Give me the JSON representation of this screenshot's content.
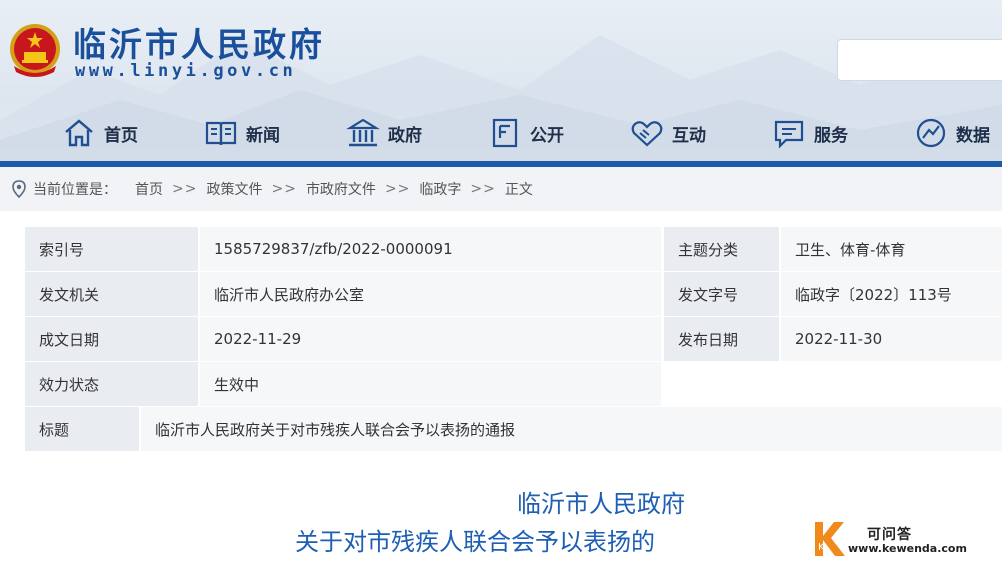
{
  "header": {
    "site_title": "临沂市人民政府",
    "site_url": "www.linyi.gov.cn",
    "search_placeholder": ""
  },
  "nav": [
    {
      "label": "首页",
      "icon": "home-icon"
    },
    {
      "label": "新闻",
      "icon": "news-icon"
    },
    {
      "label": "政府",
      "icon": "government-icon"
    },
    {
      "label": "公开",
      "icon": "document-icon"
    },
    {
      "label": "互动",
      "icon": "handshake-icon"
    },
    {
      "label": "服务",
      "icon": "chat-icon"
    },
    {
      "label": "数据",
      "icon": "data-icon"
    }
  ],
  "breadcrumb": {
    "prefix": "当前位置是：",
    "items": [
      "首页",
      "政策文件",
      "市政府文件",
      "临政字",
      "正文"
    ],
    "separator": ">>"
  },
  "info": {
    "index_label": "索引号",
    "index_value": "1585729837/zfb/2022-0000091",
    "topic_label": "主题分类",
    "topic_value": "卫生、体育-体育",
    "issuer_label": "发文机关",
    "issuer_value": "临沂市人民政府办公室",
    "docno_label": "发文字号",
    "docno_value": "临政字〔2022〕113号",
    "created_label": "成文日期",
    "created_value": "2022-11-29",
    "published_label": "发布日期",
    "published_value": "2022-11-30",
    "status_label": "效力状态",
    "status_value": "生效中",
    "title_label": "标题",
    "title_value": "临沂市人民政府关于对市残疾人联合会予以表扬的通报"
  },
  "document": {
    "title_line1": "临沂市人民政府",
    "title_line2": "关于对市残疾人联合会予以表扬的"
  },
  "watermark": {
    "letter": "K",
    "name": "可问答",
    "url": "www.kewenda.com"
  },
  "colors": {
    "brand_blue": "#1a4f9c",
    "bar_blue": "#1c5aa8",
    "title_blue": "#1e5fb3",
    "watermark_orange": "#f08a1c"
  }
}
